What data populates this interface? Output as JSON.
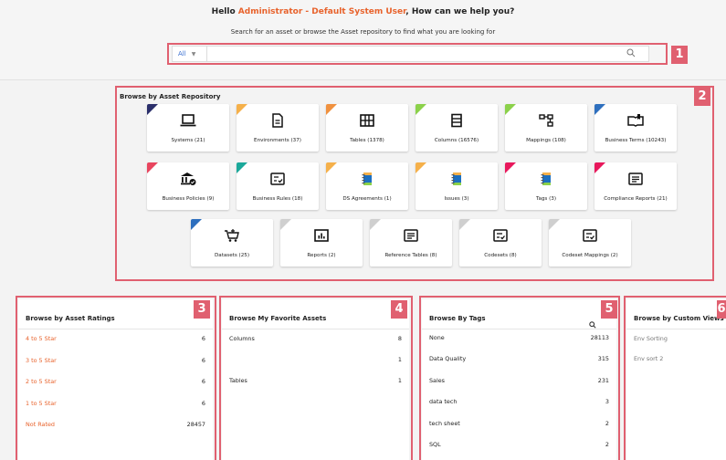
{
  "header": {
    "greeting_prefix": "Hello",
    "user": "Administrator - Default System User",
    "greeting_suffix": ", How can we help you?",
    "subtitle": "Search for an asset or browse the Asset repository to find what you are looking for"
  },
  "search": {
    "filter_value": "All",
    "value": "",
    "icon": "search-icon"
  },
  "callouts": [
    "1",
    "2",
    "3",
    "4",
    "5",
    "6"
  ],
  "repository": {
    "title": "Browse by Asset Repository",
    "cards": [
      {
        "label": "Systems (21)",
        "icon": "laptop-icon",
        "accent": "#2b2f6b"
      },
      {
        "label": "Environments (37)",
        "icon": "document-icon",
        "accent": "#f5b04a"
      },
      {
        "label": "Tables (1378)",
        "icon": "table-icon",
        "accent": "#f0913f"
      },
      {
        "label": "Columns (16576)",
        "icon": "columns-icon",
        "accent": "#8bd14a"
      },
      {
        "label": "Mappings (108)",
        "icon": "mapping-icon",
        "accent": "#8bd14a"
      },
      {
        "label": "Business Terms (10243)",
        "icon": "book-icon",
        "accent": "#2e6fbe"
      },
      {
        "label": "Business Policies (9)",
        "icon": "policy-icon",
        "accent": "#e8455e"
      },
      {
        "label": "Business Rules (18)",
        "icon": "rules-icon",
        "accent": "#1ba89a"
      },
      {
        "label": "DS Agreements (1)",
        "icon": "notebook-icon",
        "accent": "#f5b04a"
      },
      {
        "label": "Issues (3)",
        "icon": "notebook-icon",
        "accent": "#f5b04a"
      },
      {
        "label": "Tags (3)",
        "icon": "notebook-icon",
        "accent": "#e8185c"
      },
      {
        "label": "Compliance Reports (21)",
        "icon": "report-list-icon",
        "accent": "#e8185c"
      },
      {
        "label": "Datasets (25)",
        "icon": "cart-icon",
        "accent": "#2e6fbe"
      },
      {
        "label": "Reports (2)",
        "icon": "bar-chart-icon",
        "accent": "#cfcfcf"
      },
      {
        "label": "Reference Tables (8)",
        "icon": "report-list-icon",
        "accent": "#cfcfcf"
      },
      {
        "label": "Codesets (8)",
        "icon": "checklist-icon",
        "accent": "#cfcfcf"
      },
      {
        "label": "Codeset Mappings (2)",
        "icon": "checklist-icon",
        "accent": "#cfcfcf"
      }
    ]
  },
  "ratings": {
    "title": "Browse by Asset Ratings",
    "rows": [
      {
        "label": "4 to 5 Star",
        "count": "6"
      },
      {
        "label": "3 to 5 Star",
        "count": "6"
      },
      {
        "label": "2 to 5 Star",
        "count": "6"
      },
      {
        "label": "1 to 5 Star",
        "count": "6"
      },
      {
        "label": "Not Rated",
        "count": "28457"
      }
    ]
  },
  "favorites": {
    "title": "Browse My Favorite Assets",
    "rows": [
      {
        "label": "Columns",
        "count": "8"
      },
      {
        "label": "",
        "count": "1"
      },
      {
        "label": "Tables",
        "count": "1"
      }
    ]
  },
  "tags": {
    "title": "Browse By Tags",
    "icon": "search-icon",
    "rows": [
      {
        "label": "None",
        "count": "28113"
      },
      {
        "label": "Data Quality",
        "count": "315"
      },
      {
        "label": "Sales",
        "count": "231"
      },
      {
        "label": "data tech",
        "count": "3"
      },
      {
        "label": "tech sheet",
        "count": "2"
      },
      {
        "label": "SQL",
        "count": "2"
      }
    ]
  },
  "custom_views": {
    "title": "Browse by Custom Views",
    "rows": [
      {
        "label": "Env Sorting"
      },
      {
        "label": "Env sort 2"
      }
    ]
  },
  "colors": {
    "accent": "#e8622b",
    "callout": "#e06070"
  }
}
